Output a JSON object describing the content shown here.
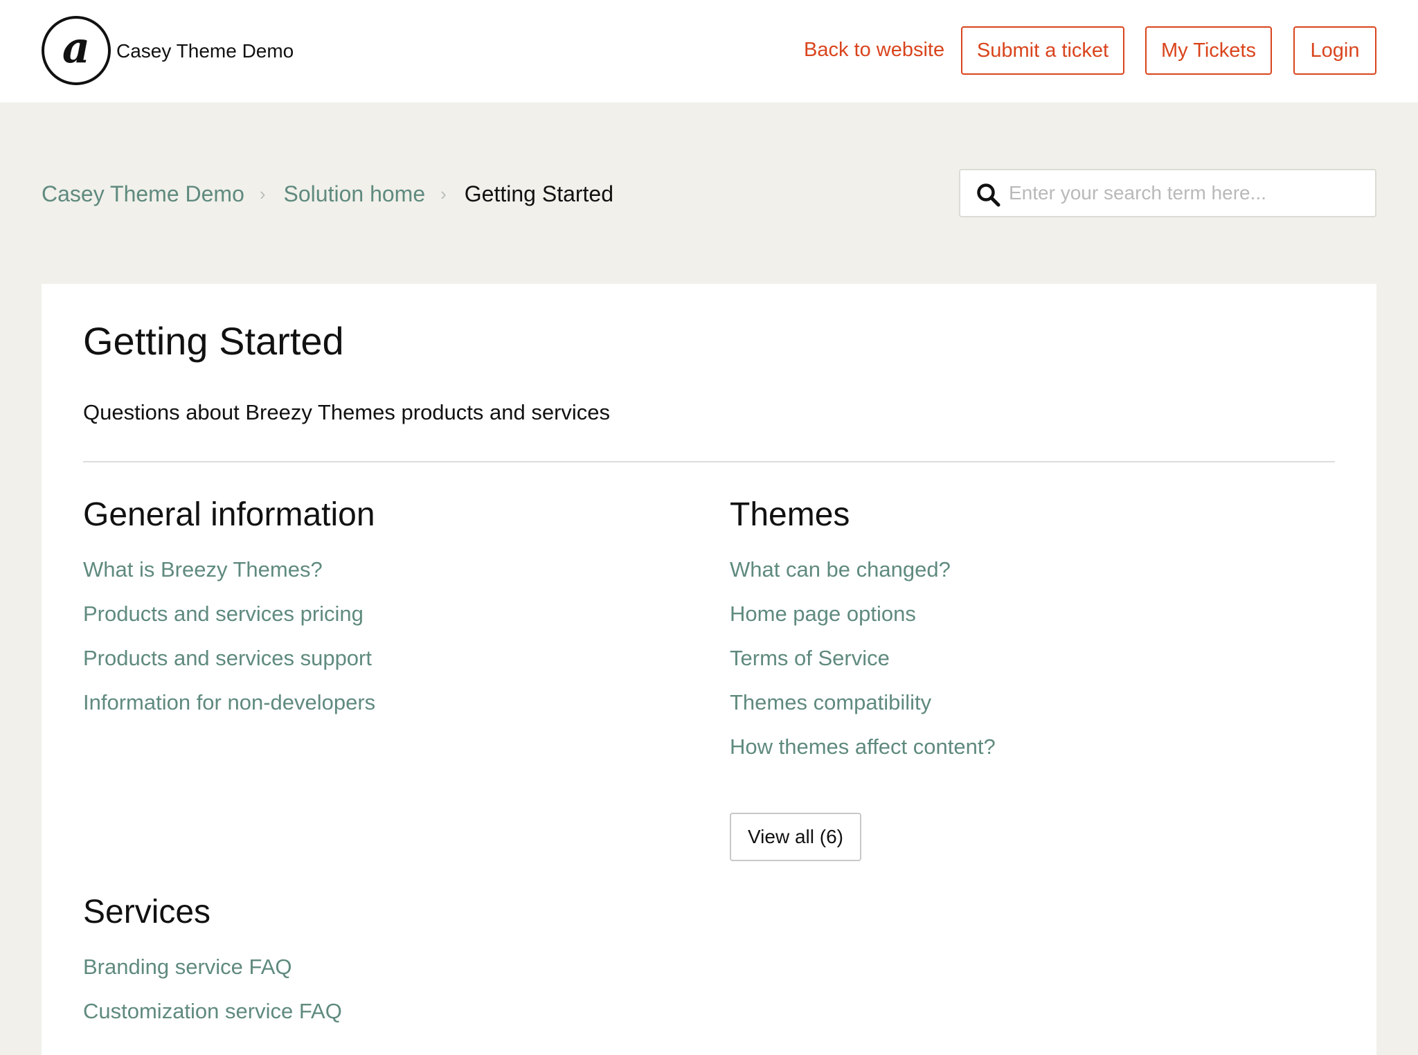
{
  "header": {
    "logo_glyph": "a",
    "site_name": "Casey Theme Demo",
    "back_link": "Back to website",
    "submit_ticket": "Submit a ticket",
    "my_tickets": "My Tickets",
    "login": "Login",
    "accent_color": "#d9441c"
  },
  "breadcrumb": {
    "items": [
      "Casey Theme Demo",
      "Solution home"
    ],
    "separator": "›",
    "current": "Getting Started"
  },
  "search": {
    "placeholder": "Enter your search term here...",
    "value": ""
  },
  "main": {
    "title": "Getting Started",
    "description": "Questions about Breezy Themes products and services",
    "sections": [
      {
        "title": "General information",
        "articles": [
          "What is Breezy Themes?",
          "Products and services pricing",
          "Products and services support",
          "Information for non-developers"
        ]
      },
      {
        "title": "Themes",
        "articles": [
          "What can be changed?",
          "Home page options",
          "Terms of Service",
          "Themes compatibility",
          "How themes affect content?"
        ],
        "view_all": "View all (6)"
      },
      {
        "title": "Services",
        "articles": [
          "Branding service FAQ",
          "Customization service FAQ"
        ]
      }
    ]
  },
  "colors": {
    "link": "#5f8a7e",
    "background": "#f1f0eb"
  }
}
